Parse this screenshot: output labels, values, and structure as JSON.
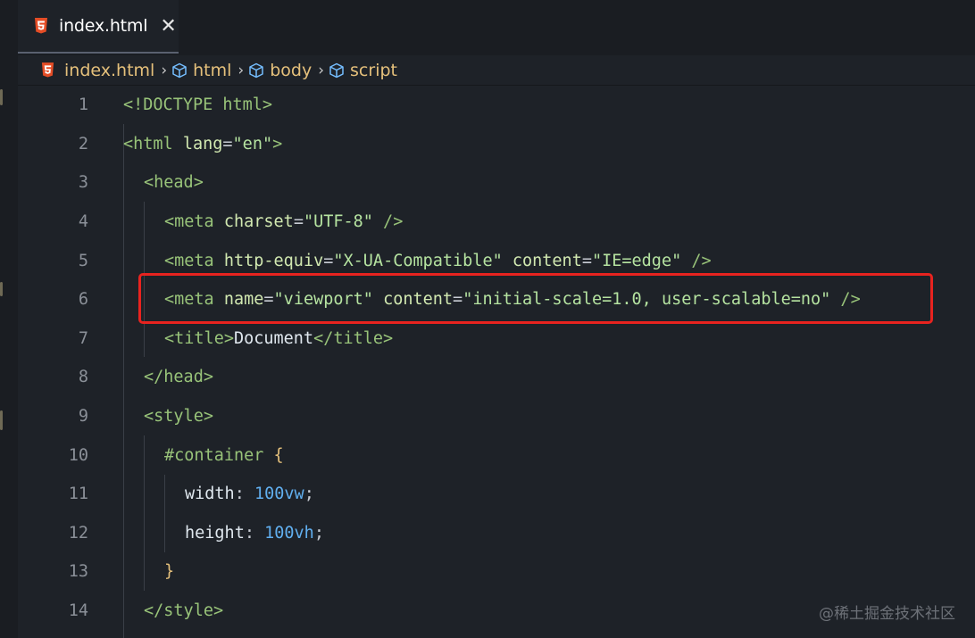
{
  "tab": {
    "label": "index.html",
    "close": "✕",
    "icon": "html5-icon"
  },
  "breadcrumb": [
    {
      "label": "index.html",
      "icon": "html5-icon"
    },
    {
      "label": "html",
      "icon": "cube-icon"
    },
    {
      "label": "body",
      "icon": "cube-icon"
    },
    {
      "label": "script",
      "icon": "cube-icon"
    }
  ],
  "breadcrumb_separator": "›",
  "lines": [
    {
      "num": "1",
      "parts": [
        [
          "tag",
          "<!DOCTYPE html>"
        ]
      ]
    },
    {
      "num": "2",
      "parts": [
        [
          "tag",
          "<html"
        ],
        [
          "attr",
          " lang"
        ],
        [
          "punc",
          "="
        ],
        [
          "str",
          "\"en\""
        ],
        [
          "tag",
          ">"
        ]
      ]
    },
    {
      "num": "3",
      "parts": [
        [
          "tag",
          "<head>"
        ]
      ]
    },
    {
      "num": "4",
      "parts": [
        [
          "tag",
          "<meta"
        ],
        [
          "attr",
          " charset"
        ],
        [
          "punc",
          "="
        ],
        [
          "str",
          "\"UTF-8\""
        ],
        [
          "tag",
          " />"
        ]
      ]
    },
    {
      "num": "5",
      "parts": [
        [
          "tag",
          "<meta"
        ],
        [
          "attr",
          " http-equiv"
        ],
        [
          "punc",
          "="
        ],
        [
          "str",
          "\"X-UA-Compatible\""
        ],
        [
          "attr",
          " content"
        ],
        [
          "punc",
          "="
        ],
        [
          "str",
          "\"IE=edge\""
        ],
        [
          "tag",
          " />"
        ]
      ]
    },
    {
      "num": "6",
      "parts": [
        [
          "tag",
          "<meta"
        ],
        [
          "attr",
          " name"
        ],
        [
          "punc",
          "="
        ],
        [
          "str",
          "\"viewport\""
        ],
        [
          "attr",
          " content"
        ],
        [
          "punc",
          "="
        ],
        [
          "str",
          "\"initial-scale=1.0, user-scalable=no\""
        ],
        [
          "tag",
          " />"
        ]
      ]
    },
    {
      "num": "7",
      "parts": [
        [
          "tag",
          "<title>"
        ],
        [
          "prop",
          "Document"
        ],
        [
          "tag",
          "</title>"
        ]
      ]
    },
    {
      "num": "8",
      "parts": [
        [
          "tag",
          "</head>"
        ]
      ]
    },
    {
      "num": "9",
      "parts": [
        [
          "tag",
          "<style>"
        ]
      ]
    },
    {
      "num": "10",
      "parts": [
        [
          "sel",
          "#container"
        ],
        [
          "punc",
          " "
        ],
        [
          "brace",
          "{"
        ]
      ]
    },
    {
      "num": "11",
      "parts": [
        [
          "prop",
          "width"
        ],
        [
          "punc",
          ": "
        ],
        [
          "num",
          "100vw"
        ],
        [
          "punc",
          ";"
        ]
      ]
    },
    {
      "num": "12",
      "parts": [
        [
          "prop",
          "height"
        ],
        [
          "punc",
          ": "
        ],
        [
          "num",
          "100vh"
        ],
        [
          "punc",
          ";"
        ]
      ]
    },
    {
      "num": "13",
      "parts": [
        [
          "brace",
          "}"
        ]
      ]
    },
    {
      "num": "14",
      "parts": [
        [
          "tag",
          "</style>"
        ]
      ]
    }
  ],
  "highlight": {
    "line": "6",
    "color": "#e8231f"
  },
  "watermark": "@稀土掘金技术社区",
  "colors": {
    "background": "#1e2228",
    "tag": "#98c379",
    "string": "#b5e3a0",
    "number": "#61afef",
    "brace": "#e5c07b",
    "breadcrumb": "#e5c07b",
    "html5_icon": "#e44d26"
  }
}
